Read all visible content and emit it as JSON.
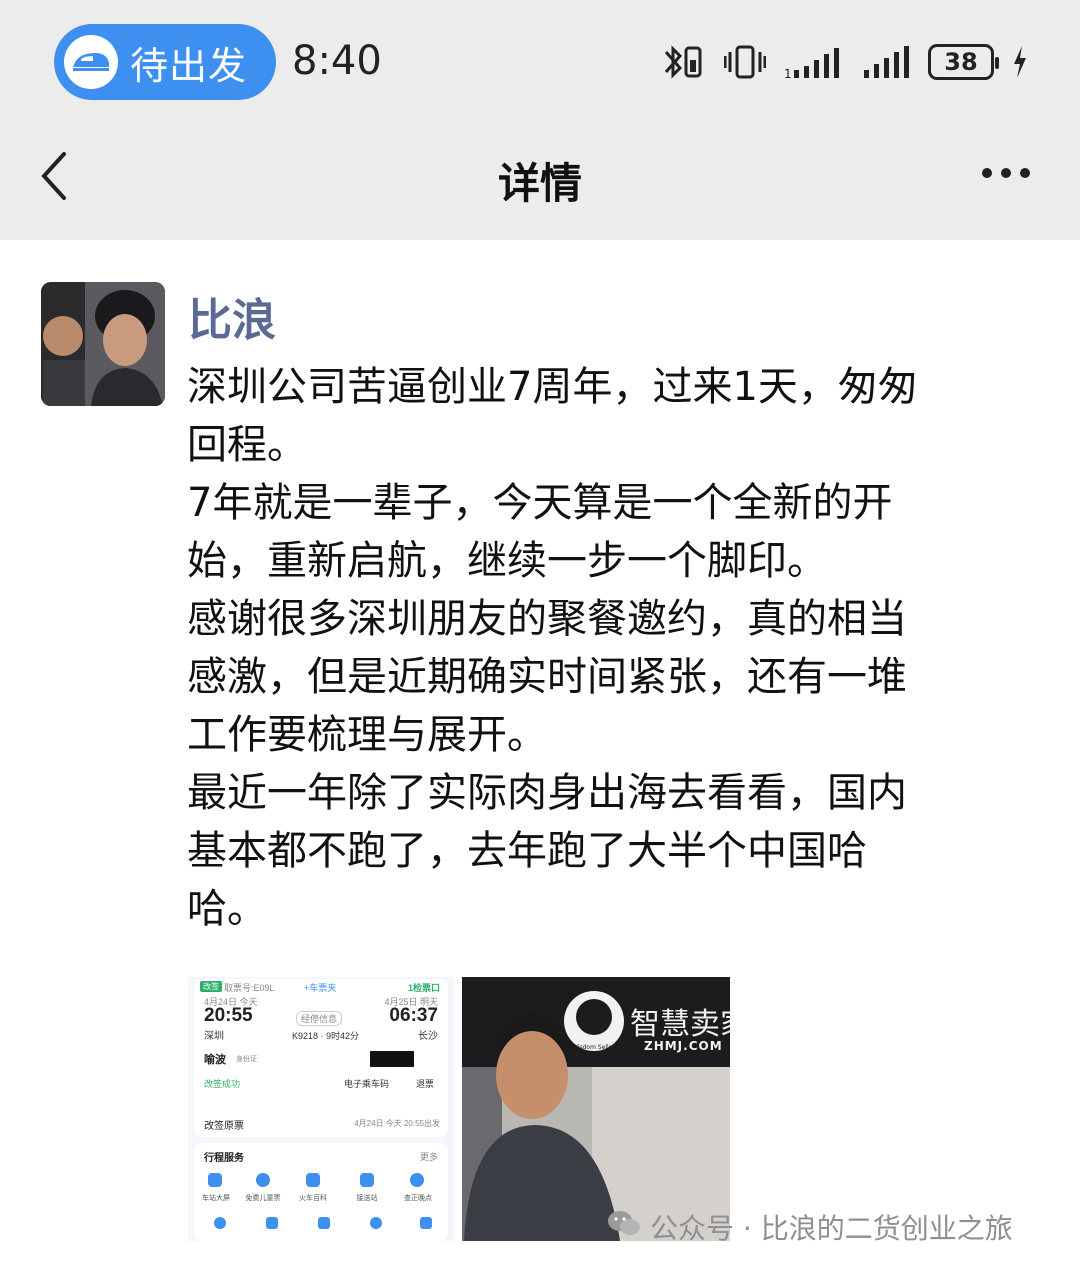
{
  "status_bar": {
    "pill_label": "待出发",
    "time": "8:40",
    "battery": "38",
    "icons": [
      "bluetooth-icon",
      "vibrate-icon",
      "signal-icon",
      "signal-icon",
      "battery-icon",
      "charging-icon"
    ]
  },
  "header": {
    "title": "详情",
    "back_icon": "chevron-left-icon",
    "more_icon": "more-dots-icon"
  },
  "post": {
    "author": "比浪",
    "paragraphs": [
      "深圳公司苦逼创业7周年，过来1天，匆匆\n回程。",
      "7年就是一辈子，今天算是一个全新的开\n始，重新启航，继续一步一个脚印。",
      "感谢很多深圳朋友的聚餐邀约，真的相当\n感激，但是近期确实时间紧张，还有一堆\n工作要梳理与展开。",
      "最近一年除了实际肉身出海去看看，国内\n基本都不跑了，去年跑了大半个中国哈\n哈。"
    ]
  },
  "ticket_image": {
    "badge": "改签",
    "order_no": "取票号:E09L",
    "tag": "+车票夹",
    "gate": "1检票口",
    "depart_date": "4月24日 今天",
    "arrive_date": "4月25日 明天",
    "depart_time": "20:55",
    "arrive_time": "06:37",
    "depart_station": "深圳",
    "arrive_station": "长沙",
    "middle_tag": "经停信息",
    "train": "K9218 · 9时42分",
    "passenger": "喻波",
    "passenger_tag": "身份证",
    "change_status": "改签成功",
    "eticket_btn": "电子乘车码",
    "refund_btn": "退票",
    "original_ticket": "改签原票",
    "original_date": "4月24日 今天 20:55出发",
    "service_title": "行程服务",
    "service_more": "更多",
    "services": [
      "车站大屏",
      "免费儿童票",
      "火车百科",
      "接送站",
      "查正晚点"
    ]
  },
  "photo_image": {
    "sign_text": "智慧卖家",
    "sign_sub": "ZHMJ.COM",
    "logo_text": "Wisdom Seller"
  },
  "watermark": {
    "text": "公众号 · 比浪的二货创业之旅"
  }
}
